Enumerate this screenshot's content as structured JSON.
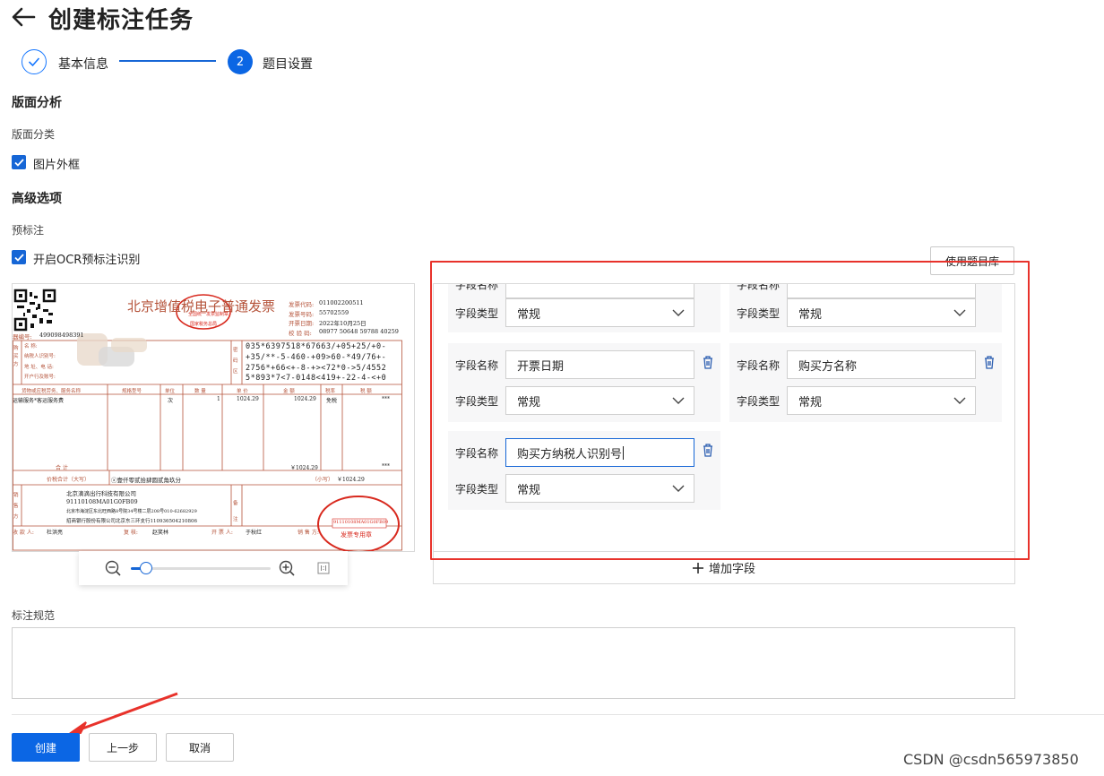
{
  "header": {
    "title": "创建标注任务"
  },
  "steps": [
    {
      "label": "基本信息"
    },
    {
      "label": "题目设置",
      "number": "2"
    }
  ],
  "layout_analysis": {
    "title": "版面分析",
    "category_label": "版面分类",
    "checkbox_label": "图片外框",
    "checked": true
  },
  "advanced": {
    "title": "高级选项",
    "prelabel_label": "预标注",
    "checkbox_label": "开启OCR预标注识别",
    "checked": true
  },
  "question_bank_button": "使用题目库",
  "fields": {
    "name_label": "字段名称",
    "type_label": "字段类型",
    "items": [
      {
        "name": "",
        "type": "常规"
      },
      {
        "name": "",
        "type": "常规"
      },
      {
        "name": "开票日期",
        "type": "常规"
      },
      {
        "name": "购买方名称",
        "type": "常规"
      },
      {
        "name": "购买方纳税人识别号",
        "type": "常规"
      }
    ],
    "add_label": "增加字段"
  },
  "invoice": {
    "title": "北京增值税电子普通发票",
    "code_label": "发票代码:",
    "code": "011002200511",
    "number_label": "发票号码:",
    "number": "55702559",
    "date_label": "开票日期:",
    "date": "2022年10月25日",
    "check_label": "校 验 码:",
    "check": "08977 50648 59788 40259",
    "machine_label": "器编号:",
    "machine": "499098498391",
    "cipher": [
      "035*6397518*67663/+05+25/+0-",
      "+35/**-5-460-+09>60-*49/76+-",
      "2756*+66<+-8-+><72*0->5/4552",
      "5*893*7<7-0148<419+-22-4-<+0"
    ],
    "buyer_labels": [
      "名  称:",
      "纳税人识别号:",
      "地 址、电 话:",
      "开户行及账号:"
    ],
    "cipher_side": "密码区",
    "buyer_side": "购买方",
    "item_headers": [
      "货物或应税劳务、服务名称",
      "规格型号",
      "单位",
      "数 量",
      "单 价",
      "金 额",
      "税率",
      "税 额"
    ],
    "item": {
      "name": "运输服务*客运服务费",
      "unit": "次",
      "qty": "1",
      "price": "1024.29",
      "amount": "1024.29",
      "rate": "免税",
      "tax": "***"
    },
    "total_label": "合 计",
    "total_amount": "￥1024.29",
    "total_tax": "***",
    "sum_label": "价税合计（大写）",
    "sum_upper": "ⓧ壹仟零贰拾肆圆贰角玖分",
    "sum_lower_label": "（小写）",
    "sum_lower": "￥1024.29",
    "seller_name": "北京滴滴出行科技有限公司",
    "seller_tax": "91110108MA01G0FB09",
    "seller_addr": "北京市海淀区东北旺西路8号院34号楼二层208号010-62682929",
    "seller_bank": "招商银行股份有限公司北京东三环支行110936504210806",
    "seller_side": "销售方",
    "remark_side": "备注",
    "payee_label": "收 款 人:",
    "payee": "杜洪亮",
    "reviewer_label": "复 核:",
    "reviewer": "赵笑林",
    "drawer_label": "开 票 人:",
    "drawer": "于秋红",
    "seller_label": "销 售 方:",
    "stamp_top": "全国统一发票监制章",
    "stamp_bottom": "国家税务总局",
    "seal_id": "91110108MA01G0FB09",
    "seal_text": "发票专用章"
  },
  "zoom": {
    "level": 0.08
  },
  "annotation_spec": {
    "label": "标注规范"
  },
  "buttons": {
    "create": "创建",
    "prev": "上一步",
    "cancel": "取消"
  },
  "watermark": "CSDN @csdn565973850",
  "colors": {
    "primary": "#0b66e4",
    "highlight": "#e8322b",
    "invoice": "#b5533a"
  }
}
